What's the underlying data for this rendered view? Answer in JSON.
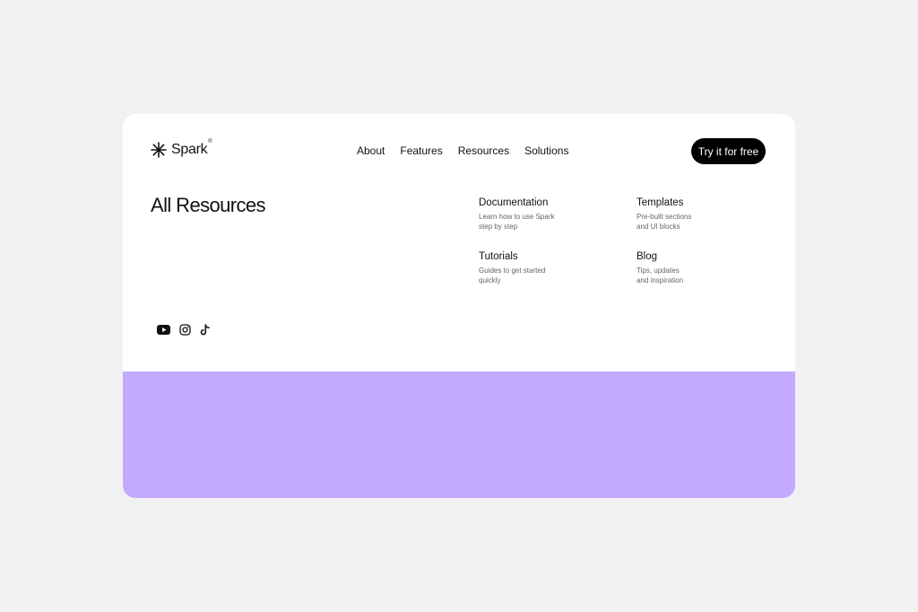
{
  "brand": {
    "name": "Spark",
    "mark": "®"
  },
  "nav": {
    "items": [
      {
        "label": "About"
      },
      {
        "label": "Features"
      },
      {
        "label": "Resources"
      },
      {
        "label": "Solutions"
      }
    ],
    "cta_label": "Try it for free"
  },
  "page": {
    "title": "All Resources"
  },
  "resources": [
    {
      "title": "Documentation",
      "description": "Learn how to use Spark\nstep by step"
    },
    {
      "title": "Templates",
      "description": "Pre-built sections\nand UI blocks"
    },
    {
      "title": "Tutorials",
      "description": "Guides to get started\nquickly"
    },
    {
      "title": "Blog",
      "description": "Tips, updates\nand inspiration"
    }
  ],
  "social": [
    {
      "icon": "youtube-icon"
    },
    {
      "icon": "instagram-icon"
    },
    {
      "icon": "tiktok-icon"
    }
  ],
  "colors": {
    "background": "#f1f1f3",
    "card": "#ffffff",
    "accent_band": "#c3aaff",
    "cta_bg": "#000000",
    "text": "#111111",
    "muted": "#666666"
  }
}
